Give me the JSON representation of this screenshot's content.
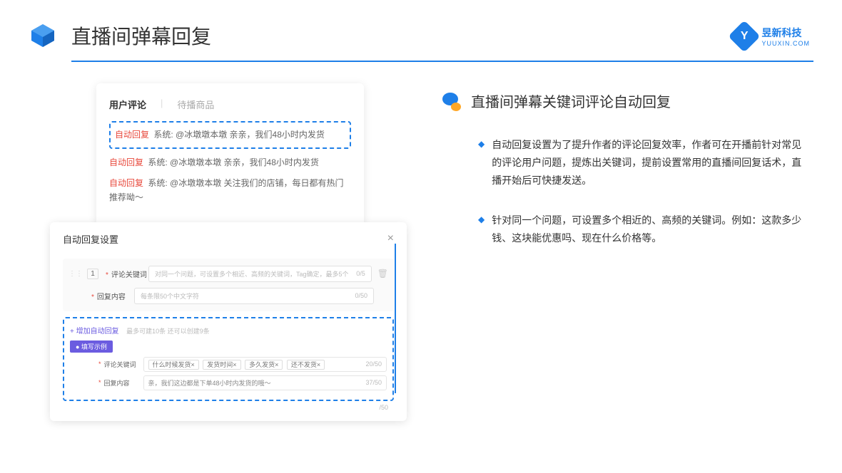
{
  "header": {
    "title": "直播间弹幕回复"
  },
  "logo": {
    "letter": "Y",
    "main": "昱新科技",
    "sub": "YUUXIN.COM"
  },
  "card1": {
    "tab1": "用户评论",
    "tab2": "待播商品",
    "autoTag": "自动回复",
    "comment1": "系统: @冰墩墩本墩 亲亲，我们48小时内发货",
    "comment2": "系统: @冰墩墩本墩 亲亲，我们48小时内发货",
    "comment3": "系统: @冰墩墩本墩 关注我们的店铺，每日都有热门推荐呦～"
  },
  "card2": {
    "title": "自动回复设置",
    "num": "1",
    "label1": "评论关键词",
    "placeholder1": "对同一个问题，可设置多个相近、高频的关键词，Tag确定，最多5个",
    "counter1": "0/5",
    "label2": "回复内容",
    "placeholder2": "每条限50个中文字符",
    "counter2": "0/50",
    "addLink": "+ 增加自动回复",
    "addHint": "最多可建10条 还可以创建9条",
    "exampleTag": "● 填写示例",
    "exLabel1": "评论关键词",
    "exTags": [
      "什么时候发货×",
      "发货时间×",
      "多久发货×",
      "还不发货×"
    ],
    "exCounter1": "20/50",
    "exLabel2": "回复内容",
    "exValue2": "亲，我们这边都是下单48小时内发货的哦～",
    "exCounter2": "37/50",
    "lastCounter": "/50"
  },
  "right": {
    "title": "直播间弹幕关键词评论自动回复",
    "bullet1": "自动回复设置为了提升作者的评论回复效率，作者可在开播前针对常见的评论用户问题，提炼出关键词，提前设置常用的直播间回复话术，直播开始后可快捷发送。",
    "bullet2": "针对同一个问题，可设置多个相近的、高频的关键词。例如：这款多少钱、这块能优惠吗、现在什么价格等。"
  }
}
